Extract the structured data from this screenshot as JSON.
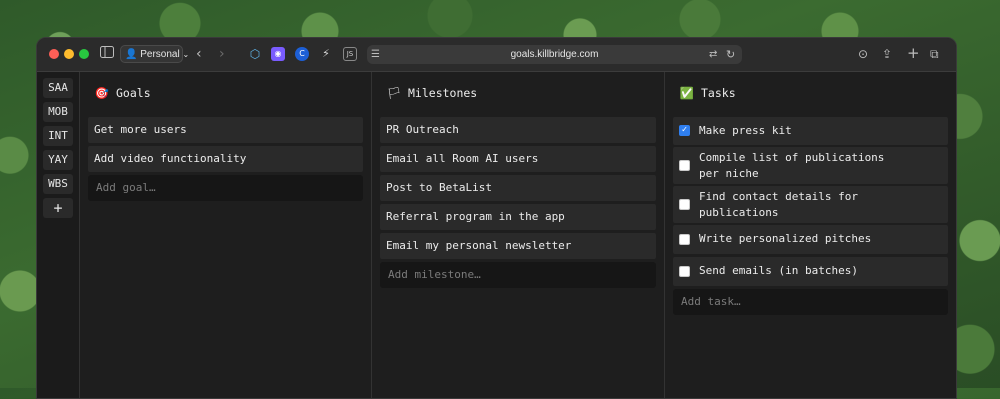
{
  "browser": {
    "profile_label": "Personal",
    "url": "goals.killbridge.com",
    "extensions": [
      "cube-ext-icon",
      "discord-ext-icon",
      "circle-ext-icon",
      "bolt-ext-icon",
      "js-ext-icon"
    ],
    "traffic_light_colors": {
      "close": "#ff5f57",
      "minimize": "#febc2e",
      "zoom": "#28c840"
    }
  },
  "rail": {
    "items": [
      "SAA",
      "MOB",
      "INT",
      "YAY",
      "WBS"
    ],
    "add_label": "+"
  },
  "goals": {
    "title": "Goals",
    "emoji": "🎯",
    "items": [
      "Get more users",
      "Add video functionality"
    ],
    "add_placeholder": "Add goal…"
  },
  "milestones": {
    "title": "Milestones",
    "emoji": "🏳",
    "items": [
      "PR Outreach",
      "Email all Room AI users",
      "Post to BetaList",
      "Referral program in the app",
      "Email my personal newsletter"
    ],
    "add_placeholder": "Add milestone…"
  },
  "tasks": {
    "title": "Tasks",
    "emoji": "✅",
    "items": [
      {
        "label": "Make press kit",
        "checked": true
      },
      {
        "label": "Compile list of publications per niche",
        "checked": false
      },
      {
        "label": "Find contact details for publications",
        "checked": false
      },
      {
        "label": "Write personalized pitches",
        "checked": false
      },
      {
        "label": "Send emails (in batches)",
        "checked": false
      }
    ],
    "add_placeholder": "Add task…"
  },
  "colors": {
    "checkbox_checked": "#2f7ff0",
    "panel_bg": "#1e1e1e",
    "card_bg": "#2a2a2a"
  }
}
